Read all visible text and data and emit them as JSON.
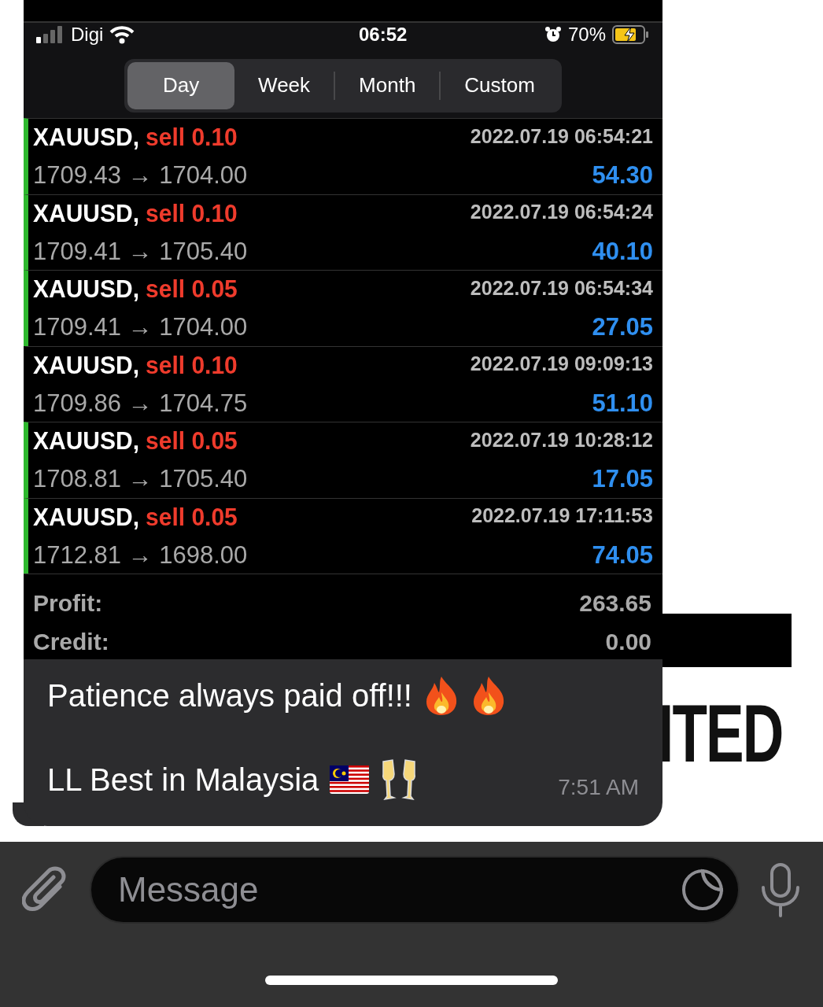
{
  "status_bar": {
    "carrier": "Digi",
    "time": "06:52",
    "battery": "70%"
  },
  "tabs": [
    {
      "label": "Day",
      "selected": true
    },
    {
      "label": "Week",
      "selected": false
    },
    {
      "label": "Month",
      "selected": false
    },
    {
      "label": "Custom",
      "selected": false
    }
  ],
  "trades": [
    {
      "symbol": "XAUUSD,",
      "side": "sell 0.10",
      "prices": "1709.43 → 1704.00",
      "time": "2022.07.19 06:54:21",
      "profit": "54.30",
      "marked": true
    },
    {
      "symbol": "XAUUSD,",
      "side": "sell 0.10",
      "prices": "1709.41 → 1705.40",
      "time": "2022.07.19 06:54:24",
      "profit": "40.10",
      "marked": true
    },
    {
      "symbol": "XAUUSD,",
      "side": "sell 0.05",
      "prices": "1709.41 → 1704.00",
      "time": "2022.07.19 06:54:34",
      "profit": "27.05",
      "marked": true
    },
    {
      "symbol": "XAUUSD,",
      "side": "sell 0.10",
      "prices": "1709.86 → 1704.75",
      "time": "2022.07.19 09:09:13",
      "profit": "51.10",
      "marked": false
    },
    {
      "symbol": "XAUUSD,",
      "side": "sell 0.05",
      "prices": "1708.81 → 1705.40",
      "time": "2022.07.19 10:28:12",
      "profit": "17.05",
      "marked": true
    },
    {
      "symbol": "XAUUSD,",
      "side": "sell 0.05",
      "prices": "1712.81 → 1698.00",
      "time": "2022.07.19 17:11:53",
      "profit": "74.05",
      "marked": true
    }
  ],
  "summary": [
    {
      "label": "Profit:",
      "value": "263.65"
    },
    {
      "label": "Credit:",
      "value": "0.00"
    }
  ],
  "message": {
    "lines": [
      {
        "text": "Patience always paid off!!!",
        "emojis": [
          {
            "kind": "fire"
          },
          {
            "kind": "fire"
          }
        ]
      },
      {
        "text": "LL Best in Malaysia",
        "emojis": [
          {
            "kind": "flag"
          },
          {
            "kind": "champagne"
          }
        ]
      }
    ],
    "time": "7:51 AM"
  },
  "background_text": "ITED",
  "input": {
    "placeholder": "Message"
  }
}
